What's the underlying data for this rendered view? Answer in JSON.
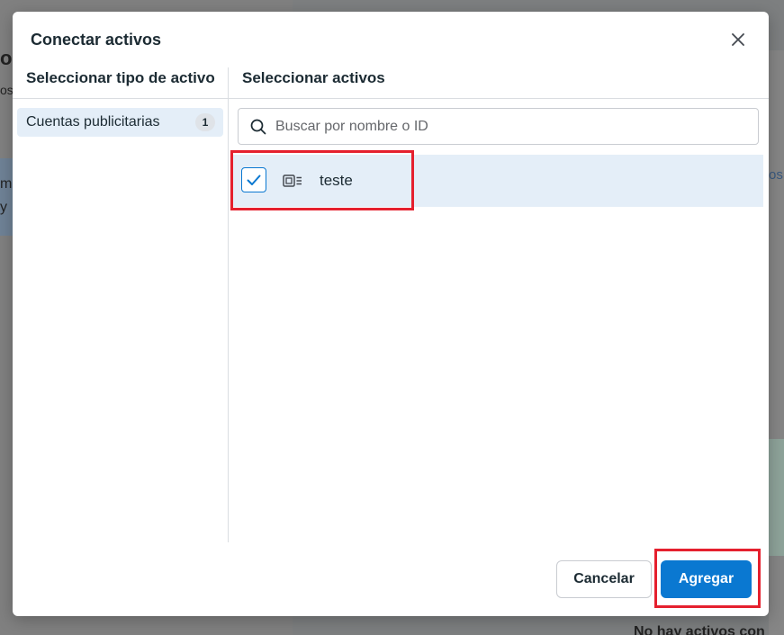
{
  "background": {
    "left_text_1": "os",
    "left_text_2": "os",
    "left_text_3": "m",
    "left_text_4": "y",
    "link_fragment": "os",
    "bottom_text": "No hay activos con"
  },
  "modal": {
    "title": "Conectar activos",
    "close_icon": "close-icon",
    "left_column": {
      "header": "Seleccionar tipo de activo",
      "items": [
        {
          "label": "Cuentas publicitarias",
          "count": "1",
          "selected": true
        }
      ]
    },
    "right_column": {
      "header": "Seleccionar activos",
      "search": {
        "placeholder": "Buscar por nombre o ID",
        "value": ""
      },
      "assets": [
        {
          "name": "teste",
          "checked": true,
          "icon": "ad-account-icon"
        }
      ]
    },
    "footer": {
      "cancel_label": "Cancelar",
      "add_label": "Agregar"
    }
  },
  "colors": {
    "accent": "#0a78d1",
    "highlight": "#e5202e",
    "selected_bg": "#e4eef8"
  }
}
